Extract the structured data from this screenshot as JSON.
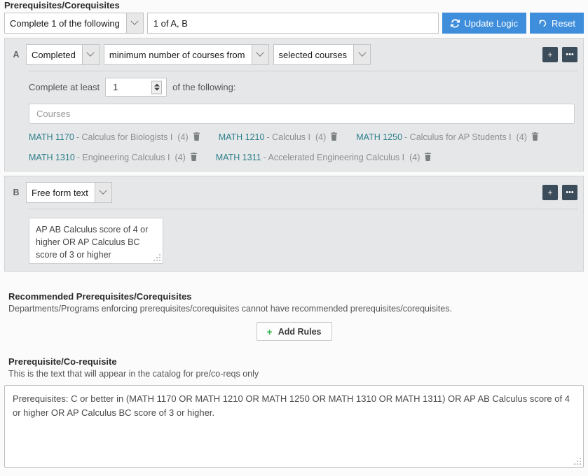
{
  "prereq_section": {
    "title": "Prerequisites/Corequisites",
    "logic_select": {
      "value": "Complete 1 of the following",
      "icon": "chevron-down-icon"
    },
    "logic_summary": "1 of A, B",
    "update_logic_button": {
      "label": "Update Logic",
      "icon": "refresh-icon"
    },
    "reset_button": {
      "label": "Reset",
      "icon": "undo-icon"
    },
    "accent_blue": "#3f8edc",
    "rules": [
      {
        "letter": "A",
        "type": "course-rule",
        "selects": [
          {
            "value": "Completed"
          },
          {
            "value": "minimum number of courses from"
          },
          {
            "value": "selected courses"
          }
        ],
        "add_button": {
          "label": "+",
          "icon": "plus-icon"
        },
        "more_button": {
          "label": "•••",
          "icon": "ellipsis-icon"
        },
        "complete_prefix": "Complete at least",
        "complete_count": "1",
        "complete_suffix": "of the following:",
        "courses_placeholder": "Courses",
        "course_rows": [
          [
            {
              "code": "MATH 1170",
              "title": "- Calculus for Biologists I",
              "credits": "(4)"
            },
            {
              "code": "MATH 1210",
              "title": "- Calculus I",
              "credits": "(4)"
            },
            {
              "code": "MATH 1250",
              "title": "- Calculus for AP Students I",
              "credits": "(4)"
            }
          ],
          [
            {
              "code": "MATH 1310",
              "title": "- Engineering Calculus I",
              "credits": "(4)"
            },
            {
              "code": "MATH 1311",
              "title": "- Accelerated Engineering Calculus I",
              "credits": "(4)"
            }
          ]
        ]
      },
      {
        "letter": "B",
        "type": "freeform-rule",
        "selects": [
          {
            "value": "Free form text"
          }
        ],
        "add_button": {
          "label": "+",
          "icon": "plus-icon"
        },
        "more_button": {
          "label": "•••",
          "icon": "ellipsis-icon"
        },
        "freeform_text": "AP AB Calculus score of 4 or higher OR AP Calculus BC score of 3 or higher"
      }
    ]
  },
  "recommended_section": {
    "title": "Recommended Prerequisites/Corequisites",
    "note": "Departments/Programs enforcing prerequisites/corequisites cannot have recommended prerequisites/corequisites.",
    "add_rules_button": {
      "label": "Add Rules",
      "icon": "plus-icon",
      "icon_color": "#35b349"
    }
  },
  "catalog_section": {
    "title": "Prerequisite/Co-requisite",
    "note": "This is the text that will appear in the catalog for pre/co-reqs only",
    "text": "Prerequisites: C or better in (MATH 1170 OR MATH 1210 OR MATH 1250 OR MATH 1310 OR MATH 1311) OR AP AB Calculus score of 4 or higher OR AP Calculus BC score of 3 or higher."
  }
}
